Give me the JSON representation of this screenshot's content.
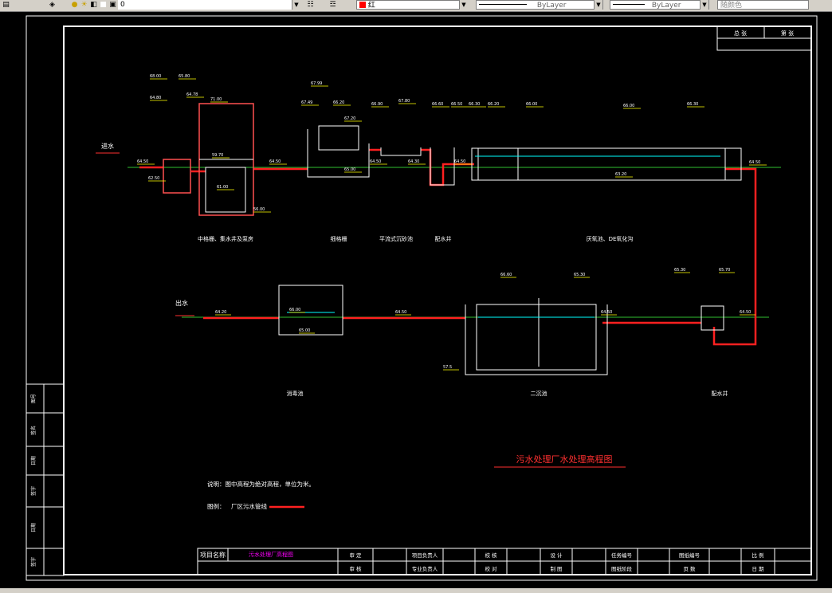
{
  "toolbar": {
    "layer_value": "0",
    "color_value": "红",
    "linetype_value": "ByLayer",
    "lineweight_value": "ByLayer",
    "plotstyle_value": "随颜色"
  },
  "title_block": {
    "project_name_label": "项目名称",
    "project_name_value": "污水处理厂高程图",
    "cells": [
      "审 定",
      "项目负责人",
      "校 核",
      "设 计",
      "任务编号",
      "图纸编号",
      "比 例",
      "审 核",
      "专业负责人",
      "校 对",
      "制 图",
      "图纸阶段",
      "页 数",
      "日 期"
    ]
  },
  "top_right_table": {
    "col1": "总  张",
    "col2": "第  张"
  },
  "left_margin_labels": [
    "图号",
    "签名",
    "日期",
    "签字",
    "日期",
    "签字"
  ],
  "drawing": {
    "title": "污水处理厂水处理高程图",
    "note": "说明：图中高程为绝对高程，单位为米。",
    "legend_label": "图例：",
    "legend_item": "厂区污水管线",
    "inlet_label": "进水",
    "outlet_label": "出水",
    "units": [
      "中格栅、集水井及泵房",
      "细格栅",
      "平流式沉砂池",
      "配水井",
      "厌氧池、DE氧化沟",
      "消毒池",
      "二沉池",
      "配水井"
    ],
    "elevations_top_row": [
      "68.00",
      "64.80",
      "65.80",
      "64.78",
      "71.00",
      "64.50",
      "62.50",
      "59.70",
      "61.00",
      "56.00",
      "64.50",
      "67.99",
      "67.49",
      "67.20",
      "66.20",
      "65.00",
      "66.90",
      "67.80",
      "64.50",
      "64.30",
      "66.60",
      "66.50",
      "66.30",
      "66.20",
      "64.50",
      "66.00",
      "66.00",
      "66.30",
      "63.20",
      "64.50"
    ],
    "elevations_bottom_row": [
      "64.20",
      "66.00",
      "65.00",
      "64.50",
      "66.60",
      "65.30",
      "64.50",
      "57.5",
      "65.30",
      "65.70",
      "64.50"
    ]
  },
  "colors": {
    "pipe": "#ff2020",
    "frame": "#ffffff",
    "ground": "#2fbf2f",
    "leader": "#ffff00",
    "water": "#00ffff",
    "title": "#ff3030",
    "accent_label": "#ff00ff"
  }
}
